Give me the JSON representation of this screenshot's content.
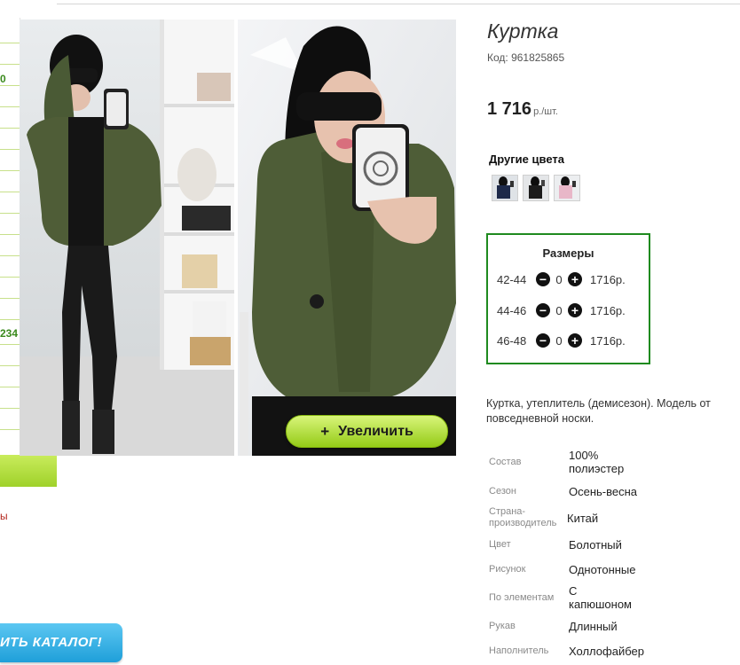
{
  "sidebar": {
    "numbers": [
      "0",
      "234"
    ],
    "red_text": "ы",
    "catalog_button": "ИТЬ КАТАЛОГ!"
  },
  "product": {
    "title": "Куртка",
    "code": "Код: 961825865",
    "price": "1 716",
    "price_unit": "р./шт.",
    "zoom_button": "Увеличить",
    "other_colors_title": "Другие цвета",
    "other_colors": [
      {
        "name": "navy",
        "color": "#1e2a4a"
      },
      {
        "name": "black",
        "color": "#1b1b1b"
      },
      {
        "name": "pink",
        "color": "#e8b7c8"
      }
    ],
    "sizes_title": "Размеры",
    "sizes": [
      {
        "size": "42-44",
        "qty": "0",
        "price": "1716р."
      },
      {
        "size": "44-46",
        "qty": "0",
        "price": "1716р."
      },
      {
        "size": "46-48",
        "qty": "0",
        "price": "1716р."
      }
    ],
    "description_line1": "Куртка, утеплитель (демисезон). Модель от",
    "description_line2": "повседневной носки.",
    "properties": [
      {
        "label": "Состав",
        "value": "100% полиэстер"
      },
      {
        "label": "Сезон",
        "value": "Осень-весна"
      },
      {
        "label": "Страна-производитель",
        "value": "Китай"
      },
      {
        "label": "Цвет",
        "value": "Болотный"
      },
      {
        "label": "Рисунок",
        "value": "Однотонные"
      },
      {
        "label": "По элементам",
        "value": "С капюшоном"
      },
      {
        "label": "Рукав",
        "value": "Длинный"
      },
      {
        "label": "Наполнитель",
        "value": "Холлофайбер"
      }
    ]
  },
  "colors": {
    "accent_green": "#1f8a1f",
    "button_green": "#a8d82a",
    "catalog_blue": "#2aa8e0"
  }
}
